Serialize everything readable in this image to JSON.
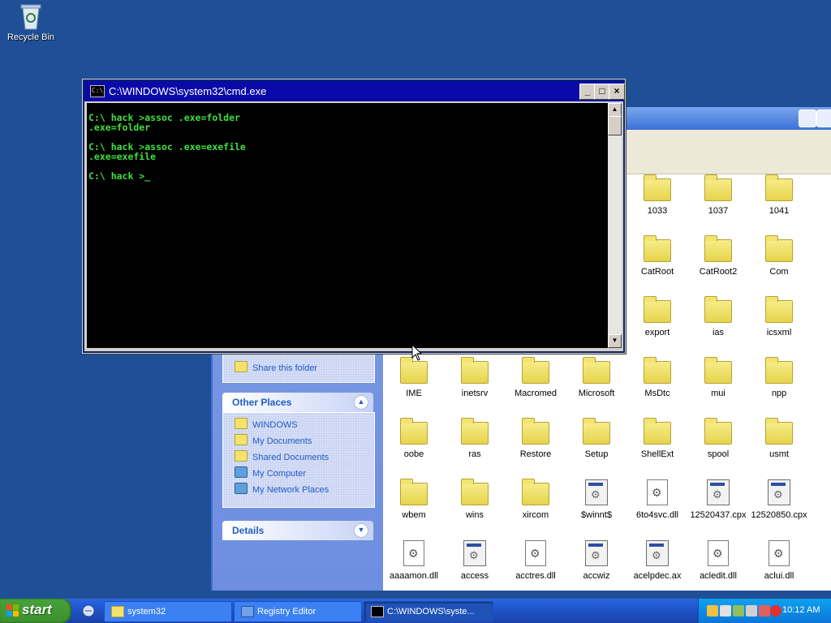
{
  "desktop": {
    "recycle_bin": "Recycle Bin"
  },
  "cmd": {
    "title": "C:\\WINDOWS\\system32\\cmd.exe",
    "icon_text": "C:\\",
    "lines": "C:\\ hack >assoc .exe=folder\n.exe=folder\n\nC:\\ hack >assoc .exe=exefile\n.exe=exefile\n\nC:\\ hack >_",
    "minimize": "_",
    "maximize": "□",
    "close": "×"
  },
  "explorer": {
    "share_folder": "Share this folder",
    "other_places": {
      "title": "Other Places",
      "items": [
        "WINDOWS",
        "My Documents",
        "Shared Documents",
        "My Computer",
        "My Network Places"
      ]
    },
    "details": {
      "title": "Details"
    },
    "files": [
      "1033",
      "1037",
      "1041",
      "CatRoot",
      "CatRoot2",
      "Com",
      "export",
      "ias",
      "icsxml",
      "IME",
      "inetsrv",
      "Macromed",
      "Microsoft",
      "MsDtc",
      "mui",
      "npp",
      "oobe",
      "ras",
      "Restore",
      "Setup",
      "ShellExt",
      "spool",
      "usmt",
      "wbem",
      "wins",
      "xircom",
      "$winnt$",
      "6to4svc.dll",
      "12520437.cpx",
      "12520850.cpx",
      "aaaamon.dll",
      "access",
      "acctres.dll",
      "accwiz",
      "acelpdec.ax",
      "acledit.dll",
      "aclui.dll"
    ]
  },
  "taskbar": {
    "start": "start",
    "tasks": [
      "system32",
      "Registry Editor",
      "C:\\WINDOWS\\syste..."
    ],
    "clock": "10:12 AM"
  }
}
